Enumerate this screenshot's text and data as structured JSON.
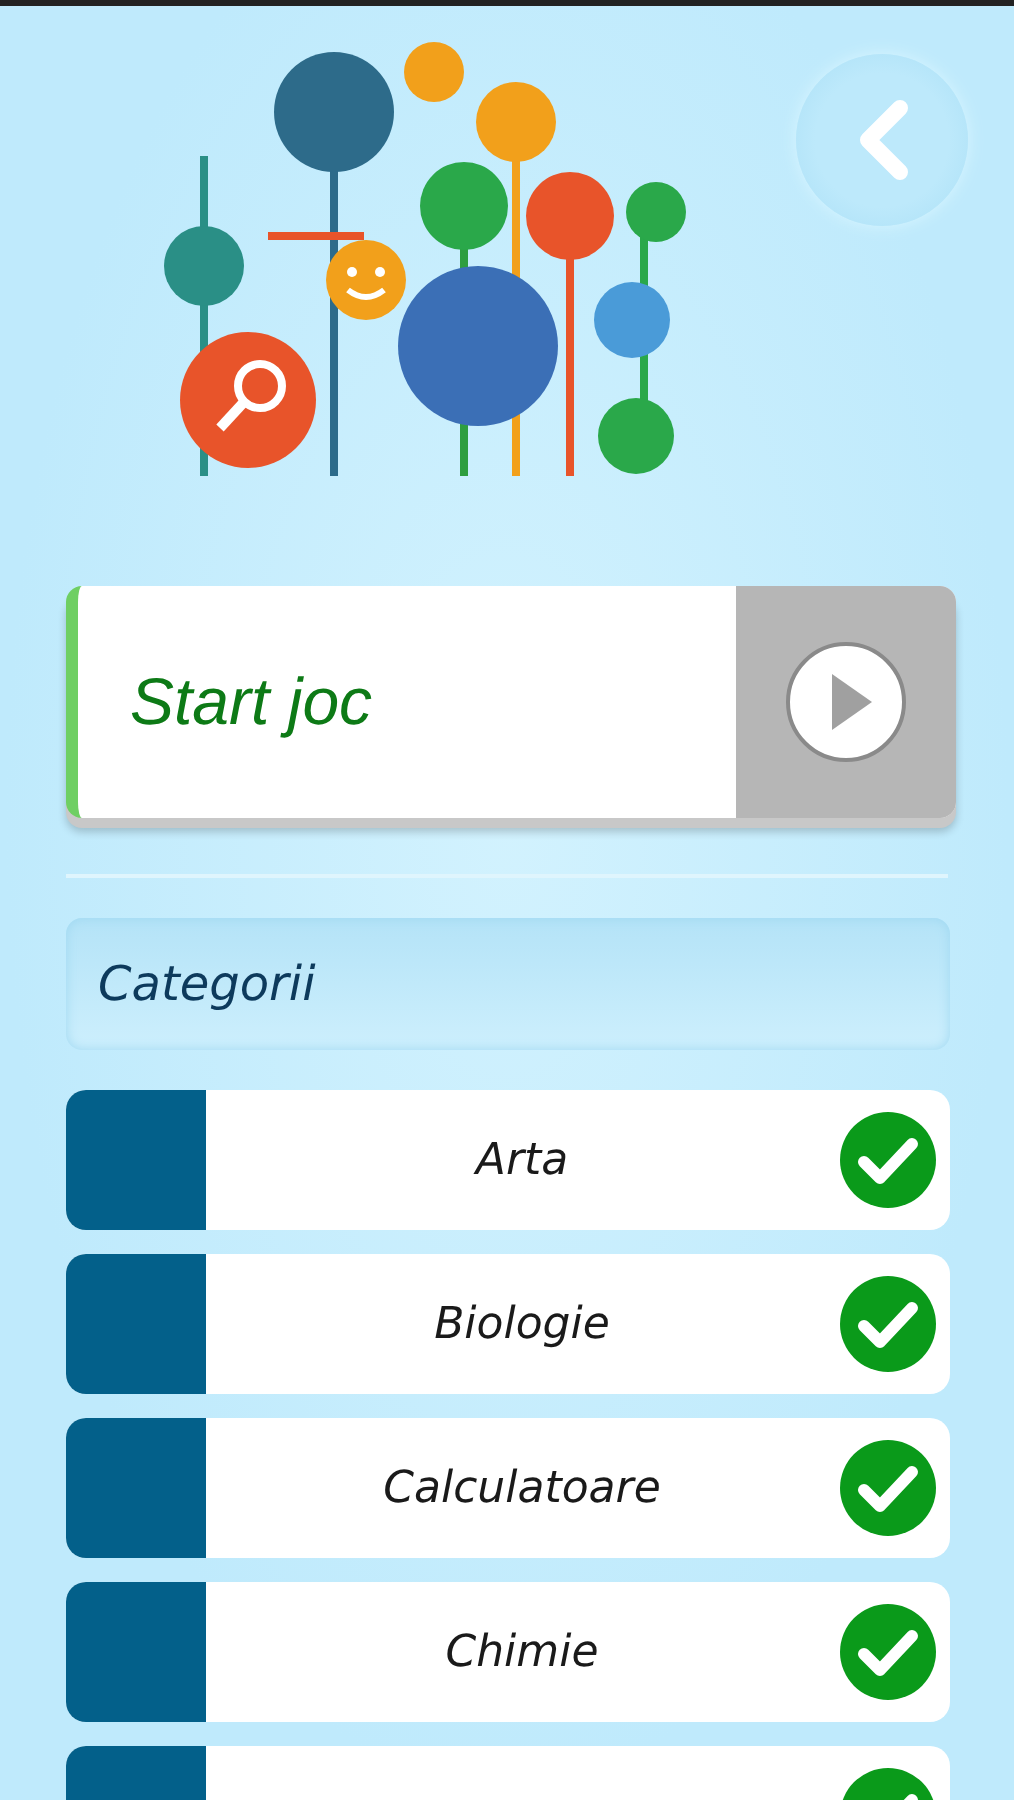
{
  "start_button": {
    "label": "Start joc"
  },
  "categories_header": {
    "title": "Categorii"
  },
  "categories": [
    {
      "label": "Arta",
      "checked": true
    },
    {
      "label": "Biologie",
      "checked": true
    },
    {
      "label": "Calculatoare",
      "checked": true
    },
    {
      "label": "Chimie",
      "checked": true
    },
    {
      "checked": true
    }
  ]
}
